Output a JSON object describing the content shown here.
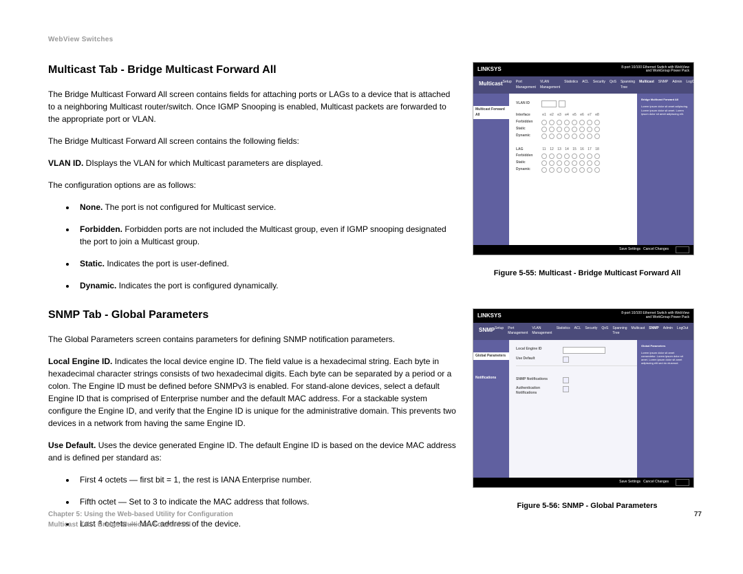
{
  "header": "WebView Switches",
  "section1": {
    "title": "Multicast Tab - Bridge Multicast Forward All",
    "intro": "The Bridge Multicast Forward All screen contains fields for attaching ports or LAGs to a device that is attached to a neighboring Multicast router/switch. Once IGMP Snooping is enabled, Multicast packets are forwarded to the appropriate port or VLAN.",
    "fields_intro": "The Bridge Multicast Forward All screen contains the following fields:",
    "vlan_label": "VLAN ID.",
    "vlan_text": " DIsplays the VLAN for which Multicast parameters are displayed.",
    "config_intro": "The configuration options are as follows:",
    "opts": [
      {
        "label": "None.",
        "text": " The port is not configured for Multicast service."
      },
      {
        "label": "Forbidden.",
        "text": " Forbidden ports are not included the Multicast group, even if IGMP snooping designated the port to join a Multicast group."
      },
      {
        "label": "Static.",
        "text": " Indicates the port is user-defined."
      },
      {
        "label": "Dynamic.",
        "text": " Indicates the port is configured dynamically."
      }
    ]
  },
  "section2": {
    "title": "SNMP Tab - Global Parameters",
    "intro": "The Global Parameters screen contains parameters for defining SNMP notification parameters.",
    "local_label": "Local Engine ID.",
    "local_text": " Indicates the local device engine ID. The field value is a hexadecimal string. Each byte in hexadecimal character strings consists of two hexadecimal digits. Each byte can be separated by a period or a colon. The Engine ID must be defined before SNMPv3 is enabled. For stand-alone devices, select a default Engine ID that is comprised of Enterprise number and the default MAC address. For a stackable system configure the Engine ID, and verify that the Engine ID is unique for the administrative domain. This prevents two devices in a network from having the same Engine ID.",
    "default_label": "Use Default.",
    "default_text": " Uses the device generated Engine ID. The default Engine ID is based on the device MAC address and is defined per standard as:",
    "bullets": [
      "First 4 octets — first bit = 1, the rest is IANA Enterprise number.",
      "Fifth octet — Set to 3 to indicate the MAC address that follows.",
      "Last 6 octets — MAC address of the device."
    ]
  },
  "figures": {
    "brand": "LINKSYS",
    "f55": {
      "side_title": "Multicast",
      "side_tab": "Multicast Forward All",
      "caption": "Figure 5-55: Multicast - Bridge Multicast Forward All",
      "rows": [
        "Interface",
        "Forbidden",
        "Static",
        "Dynamic"
      ],
      "cols1": [
        "e1",
        "e2",
        "e3",
        "e4",
        "e5",
        "e6",
        "e7",
        "e8"
      ],
      "cols2": [
        "LAG",
        "11",
        "12",
        "13",
        "14",
        "15",
        "16",
        "17",
        "18"
      ],
      "info_title": "Bridge Multicast Forward All"
    },
    "f56": {
      "side_title": "SNMP",
      "side_tab": "Global Parameters",
      "side_tab2": "Notifications",
      "caption": "Figure 5-56: SNMP - Global Parameters",
      "fields": {
        "engine": "Local Engine ID",
        "use_default": "Use Default",
        "notif": "SNMP Notifications",
        "auth": "Authentication Notifications"
      },
      "info_title": "Global Parameters"
    },
    "bottom": {
      "save": "Save Settings",
      "cancel": "Cancel Changes"
    }
  },
  "footer": {
    "line1": "Chapter 5: Using the Web-based Utility for Configuration",
    "line2": "Multicast Tab - Bridge Multicast Forward All",
    "page": "77"
  }
}
